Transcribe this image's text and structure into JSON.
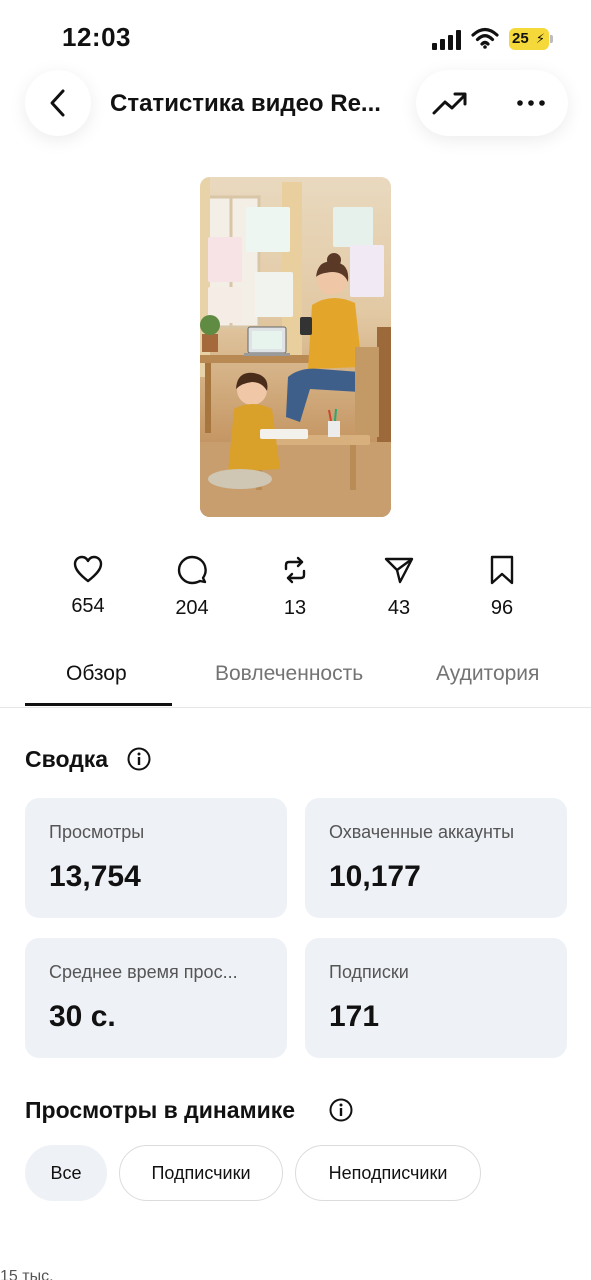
{
  "status_bar": {
    "time": "12:03",
    "battery": "25"
  },
  "header": {
    "title": "Статистика видео Re...",
    "back_icon": "chevron-left-icon",
    "trend_icon": "trending-up-icon",
    "more_icon": "more-horizontal-icon"
  },
  "metrics": [
    {
      "icon": "heart-icon",
      "value": "654"
    },
    {
      "icon": "comment-icon",
      "value": "204"
    },
    {
      "icon": "repost-icon",
      "value": "13"
    },
    {
      "icon": "share-icon",
      "value": "43"
    },
    {
      "icon": "bookmark-icon",
      "value": "96"
    }
  ],
  "tabs": [
    {
      "label": "Обзор",
      "active": true
    },
    {
      "label": "Вовлеченность",
      "active": false
    },
    {
      "label": "Аудитория",
      "active": false
    }
  ],
  "summary": {
    "title": "Сводка",
    "cards": [
      {
        "label": "Просмотры",
        "value": "13,754"
      },
      {
        "label": "Охваченные аккаунты",
        "value": "10,177"
      },
      {
        "label": "Среднее время прос...",
        "value": "30 с."
      },
      {
        "label": "Подписки",
        "value": "171"
      }
    ]
  },
  "views_dynamics": {
    "title": "Просмотры в динамике",
    "filters": [
      {
        "label": "Все",
        "selected": true
      },
      {
        "label": "Подписчики",
        "selected": false
      },
      {
        "label": "Неподписчики",
        "selected": false
      }
    ]
  },
  "footnote": "15 тыс."
}
